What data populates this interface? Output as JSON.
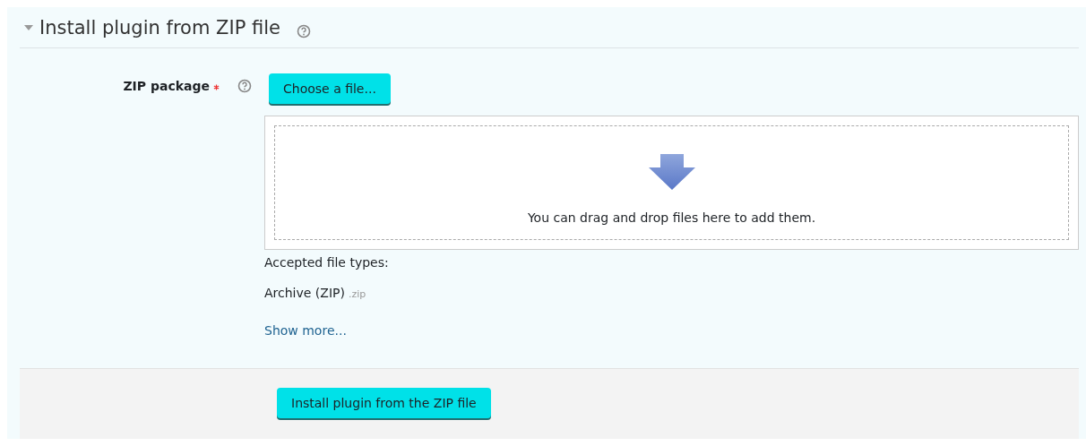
{
  "section": {
    "title": "Install plugin from ZIP file",
    "expanded": true
  },
  "field": {
    "label": "ZIP package",
    "required": true,
    "choose_button": "Choose a file...",
    "dropzone_text": "You can drag and drop files here to add them.",
    "accepted_label": "Accepted file types:",
    "file_type": "Archive (ZIP)",
    "file_ext": ".zip",
    "show_more": "Show more..."
  },
  "submit_button": "Install plugin from the ZIP file"
}
